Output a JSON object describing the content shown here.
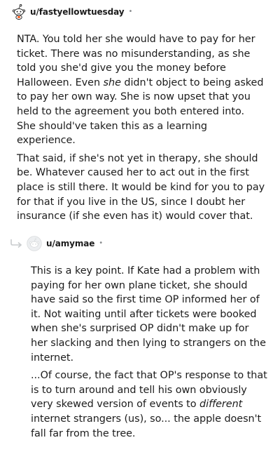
{
  "comment1": {
    "username": "u/fastyellowtuesday",
    "separator": "•",
    "avatar_icon": "snoo-avatar-icon",
    "paragraph1": {
      "before_emphasis": "NTA. You told her she would have to pay for her ticket. There was no misunderstanding, as she told you she'd give you the money before Halloween. Even ",
      "emphasis": "she",
      "after_emphasis": " didn't object to being asked to pay her own way. She is now upset that you held to the agreement you both entered into. She should've taken this as a learning experience."
    },
    "paragraph2": "That said, if she's not yet in therapy, she should be. Whatever caused her to act out in the first place is still there. It would be kind for you to pay for that if you live in the US, since I doubt her insurance (if she even has it) would cover that."
  },
  "comment2": {
    "username": "u/amymae",
    "separator": "•",
    "avatar_icon": "default-avatar-icon",
    "reply_icon": "reply-arrow-icon",
    "paragraph1": "This is a key point. If Kate had a problem with paying for her own plane ticket, she should have said so the first time OP informed her of it. Not waiting until after tickets were booked when she's surprised OP didn't make up for her slacking and then lying to strangers on the internet.",
    "paragraph2": {
      "before_emphasis": "...Of course, the fact that OP's response to that is to turn around and tell his own obviously very skewed version of events to ",
      "emphasis": "different",
      "after_emphasis": " internet strangers (us), so... the apple doesn't fall far from the tree."
    }
  },
  "colors": {
    "text": "#1c1c1c",
    "meta": "#878a8c",
    "reply_arrow": "#c8cbcd",
    "avatar_placeholder": "#edeff1"
  }
}
